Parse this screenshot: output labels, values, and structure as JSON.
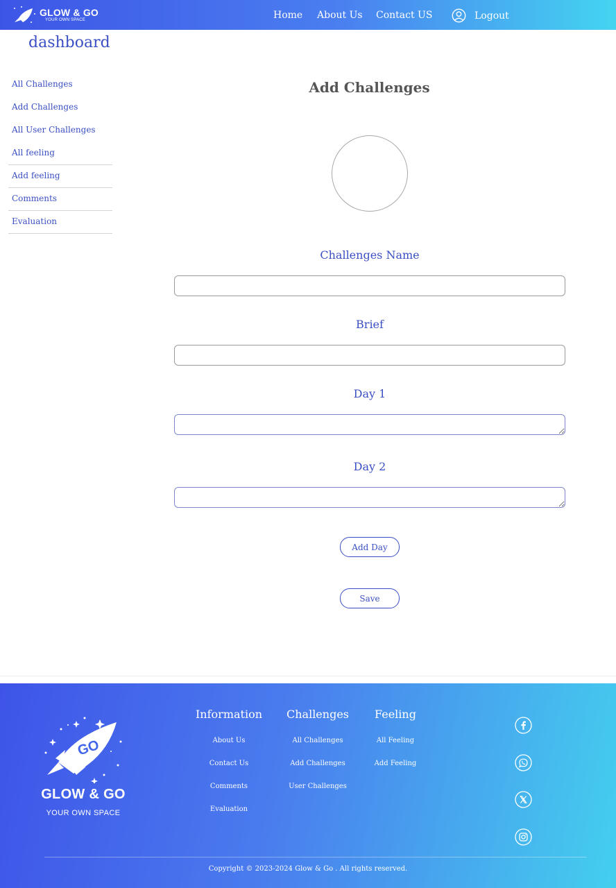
{
  "brand": {
    "name": "GLOW & GO",
    "tagline": "YOUR OWN SPACE"
  },
  "nav": {
    "home": "Home",
    "about": "About Us",
    "contact": "Contact US",
    "logout": "Logout"
  },
  "sidebar": {
    "title": "dashboard",
    "items": [
      {
        "label": "All Challenges"
      },
      {
        "label": "Add Challenges"
      },
      {
        "label": "All User Challenges"
      },
      {
        "label": "All feeling"
      },
      {
        "label": "Add feeling"
      },
      {
        "label": "Comments"
      },
      {
        "label": "Evaluation"
      }
    ]
  },
  "form": {
    "title": "Add Challenges",
    "fields": {
      "name": {
        "label": "Challenges Name",
        "value": ""
      },
      "brief": {
        "label": "Brief",
        "value": ""
      },
      "day1": {
        "label": "Day 1",
        "value": ""
      },
      "day2": {
        "label": "Day 2",
        "value": ""
      }
    },
    "add_day_label": "Add Day",
    "save_label": "Save"
  },
  "footer": {
    "logo_mark": "GO",
    "brand_name": "GLOW & GO",
    "tagline": "YOUR OWN SPACE",
    "columns": {
      "information": {
        "title": "Information",
        "links": [
          "About Us",
          "Contact Us",
          "Comments",
          "Evaluation"
        ]
      },
      "challenges": {
        "title": "Challenges",
        "links": [
          "All Challenges",
          "Add Challenges",
          "User Challenges"
        ]
      },
      "feeling": {
        "title": "Feeling",
        "links": [
          "All Feeling",
          "Add Feeling"
        ]
      }
    },
    "social": [
      "facebook-icon",
      "whatsapp-icon",
      "x-icon",
      "instagram-icon"
    ],
    "copyright": "Copyright © 2023-2024 Glow & Go . All rights reserved."
  },
  "colors": {
    "accent": "#3b4fc4",
    "gradient_start": "#3d55e6",
    "gradient_end": "#44d4f0"
  }
}
